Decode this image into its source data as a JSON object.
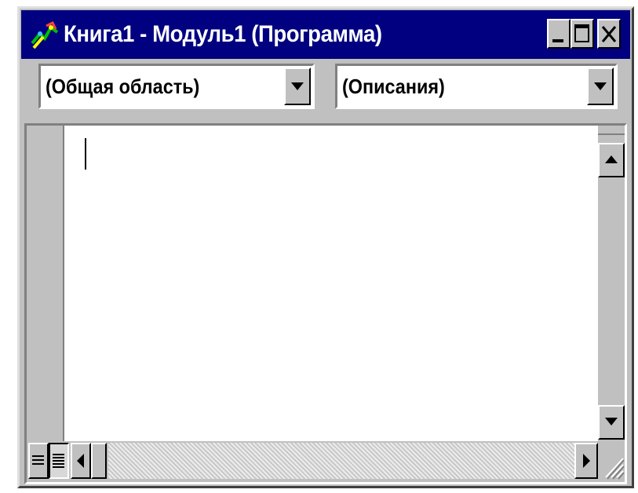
{
  "window": {
    "title": "Книга1 - Модуль1 (Программа)",
    "titlebar_color": "#000080",
    "face_color": "#c0c0c0"
  },
  "titlebar_buttons": {
    "minimize_icon": "minimize-icon",
    "maximize_icon": "maximize-icon",
    "close_icon": "close-icon"
  },
  "object_combo": {
    "value": "(Общая область)"
  },
  "procedure_combo": {
    "value": "(Описания)"
  },
  "editor": {
    "content": ""
  },
  "bottom_bar": {
    "procedure_view_icon": "procedure-view-icon",
    "full_module_view_icon": "full-module-view-icon"
  }
}
